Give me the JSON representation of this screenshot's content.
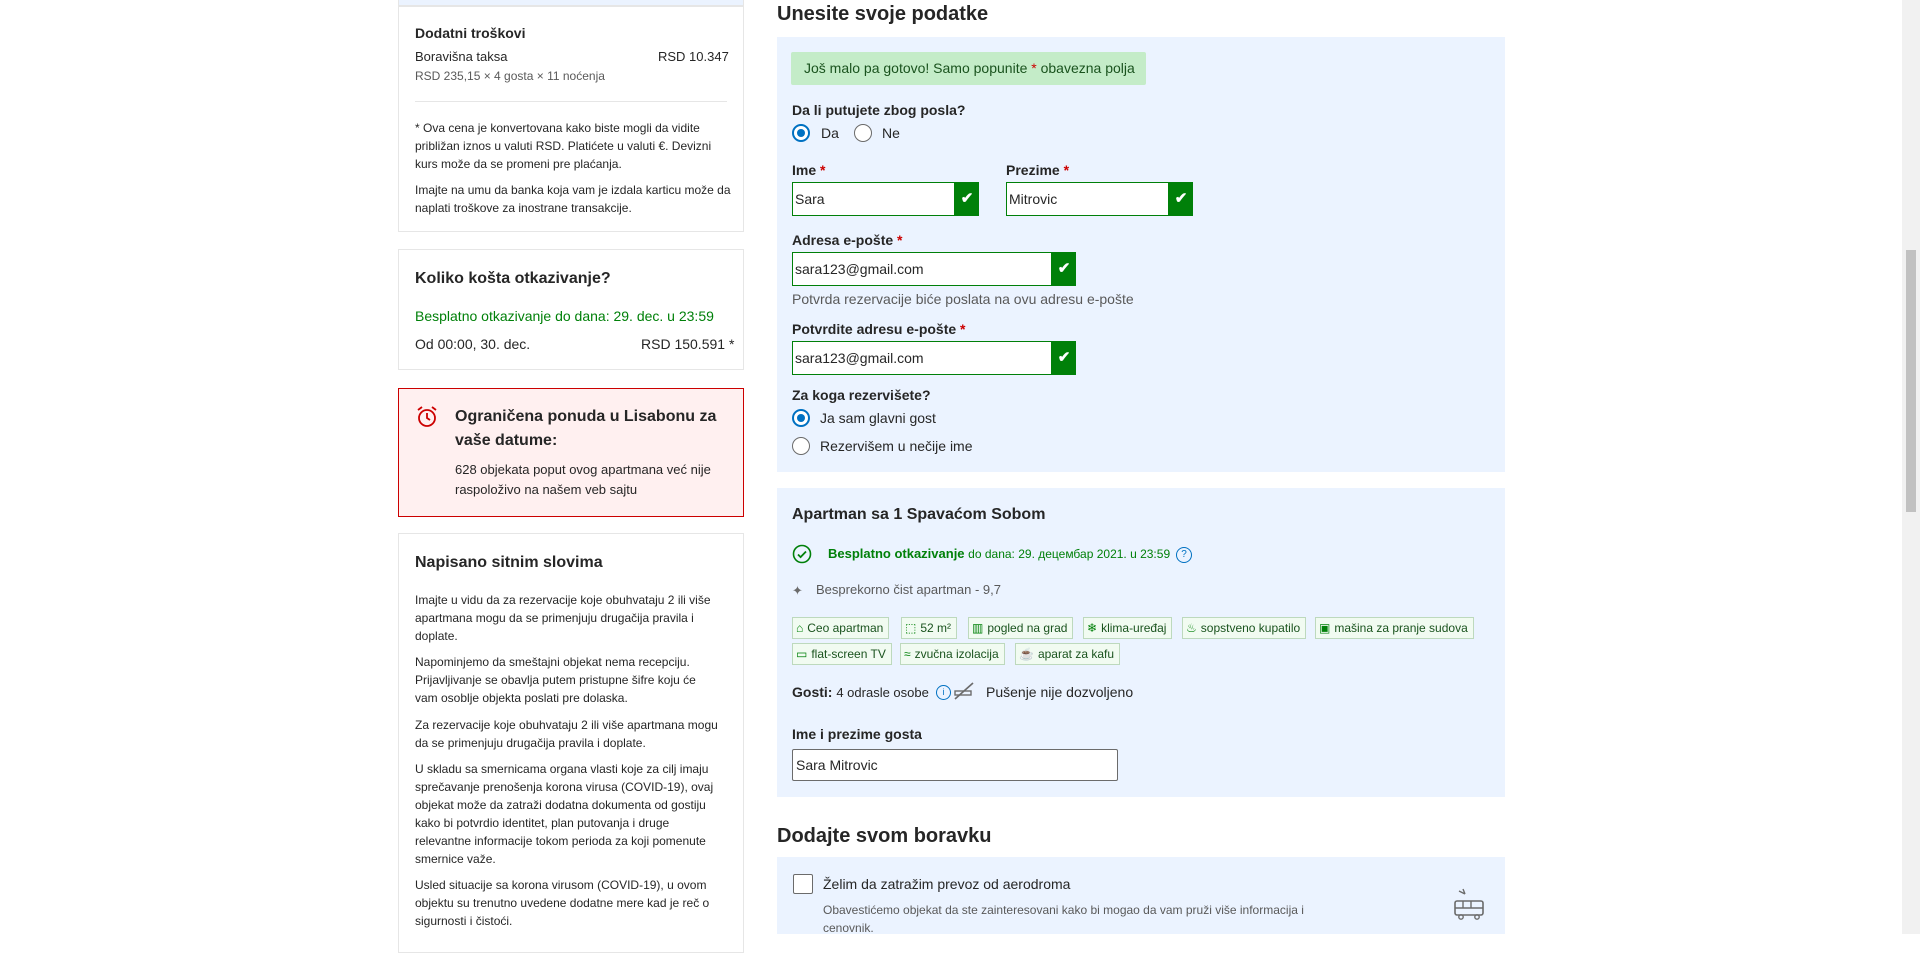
{
  "colors": {
    "brand_blue": "#0071c2",
    "success_green": "#008009",
    "error_red": "#cc0000",
    "panel_bg": "#ebf3ff"
  },
  "costs": {
    "title": "Dodatni troškovi",
    "tax_label": "Boravišna taksa",
    "tax_value": "RSD 10.347",
    "tax_detail": "RSD 235,15 × 4 gosta × 11 noćenja",
    "note1": "* Ova cena je konvertovana kako biste mogli da vidite približan iznos u valuti RSD. Platićete u valuti €. Devizni kurs može da se promeni pre plaćanja.",
    "note2": "Imajte na umu da banka koja vam je izdala karticu može da naplati troškove za inostrane transakcije."
  },
  "cancellation": {
    "title": "Koliko košta otkazivanje?",
    "free_text": "Besplatno otkazivanje do dana: 29. dec. u 23:59",
    "from_label": "Od 00:00, 30. dec.",
    "from_value": "RSD 150.591 *"
  },
  "offer": {
    "icon": "alarm-clock-icon",
    "title": "Ograničena ponuda u Lisabonu za vaše datume:",
    "body": "628 objekata poput ovog apartmana već nije raspoloživo na našem veb sajtu"
  },
  "fine_print": {
    "title": "Napisano sitnim slovima",
    "p1": "Imajte u vidu da za rezervacije koje obuhvataju 2 ili više apartmana mogu da se primenjuju drugačija pravila i doplate.",
    "p2": "Napominjemo da smeštajni objekat nema recepciju. Prijavljivanje se obavlja putem pristupne šifre koju će vam osoblje objekta poslati pre dolaska.",
    "p3": "Za rezervacije koje obuhvataju 2 ili više apartmana mogu da se primenjuju drugačija pravila i doplate.",
    "p4": "U skladu sa smernicama organa vlasti koje za cilj imaju sprečavanje prenošenja korona virusa (COVID-19), ovaj objekat može da zatraži dodatna dokumenta od gostiju kako bi potvrdio identitet, plan putovanja i druge relevantne informacije tokom perioda za koji pomenute smernice važe.",
    "p5": "Usled situacije sa korona virusom (COVID-19), u ovom objektu su trenutno uvedene dodatne mere kad je reč o sigurnosti i čistoći."
  },
  "form": {
    "section_title": "Unesite svoje podatke",
    "notice_text": "Još malo pa gotovo! Samo popunite",
    "notice_star": "*",
    "notice_tail": "obavezna polja",
    "business_q": "Da li putujete zbog posla?",
    "business_yes": "Da",
    "business_no": "Ne",
    "first_name_label": "Ime",
    "first_name_value": "Sara",
    "last_name_label": "Prezime",
    "last_name_value": "Mitrovic",
    "email_label": "Adresa e-pošte",
    "email_value": "sara123@gmail.com",
    "email_hint": "Potvrda rezervacije biće poslata na ovu adresu e-pošte",
    "email_confirm_label": "Potvrdite adresu e-pošte",
    "email_confirm_value": "sara123@gmail.com",
    "star": "*",
    "check": "✔",
    "for_whom_q": "Za koga rezervišete?",
    "for_whom_main": "Ja sam glavni gost",
    "for_whom_other": "Rezervišem u nečije ime"
  },
  "room": {
    "title": "Apartman sa 1 Spavaćom Sobom",
    "free_cancel_bold": "Besplatno otkazivanje",
    "free_cancel_rest": "do dana: 29. децембар 2021. u 23:59",
    "clean": "Besprekorno čist apartman - 9,7",
    "amenities": [
      "Ceo apartman",
      "52 m²",
      "pogled na grad",
      "klima-uređaj",
      "sopstveno kupatilo",
      "mašina za pranje sudova",
      "flat-screen TV",
      "zvučna izolacija",
      "aparat za kafu"
    ],
    "guests_label": "Gosti:",
    "guests_value": "4 odrasle osobe",
    "smoking": "Pušenje nije dozvoljeno",
    "guest_name_label": "Ime i prezime gosta",
    "guest_name_value": "Sara Mitrovic"
  },
  "addons": {
    "title": "Dodajte svom boravku",
    "transfer_label": "Želim da zatražim prevoz od aerodroma",
    "transfer_hint": "Obavestićemo objekat da ste zainteresovani kako bi mogao da vam pruži više informacija i cenovnik."
  }
}
